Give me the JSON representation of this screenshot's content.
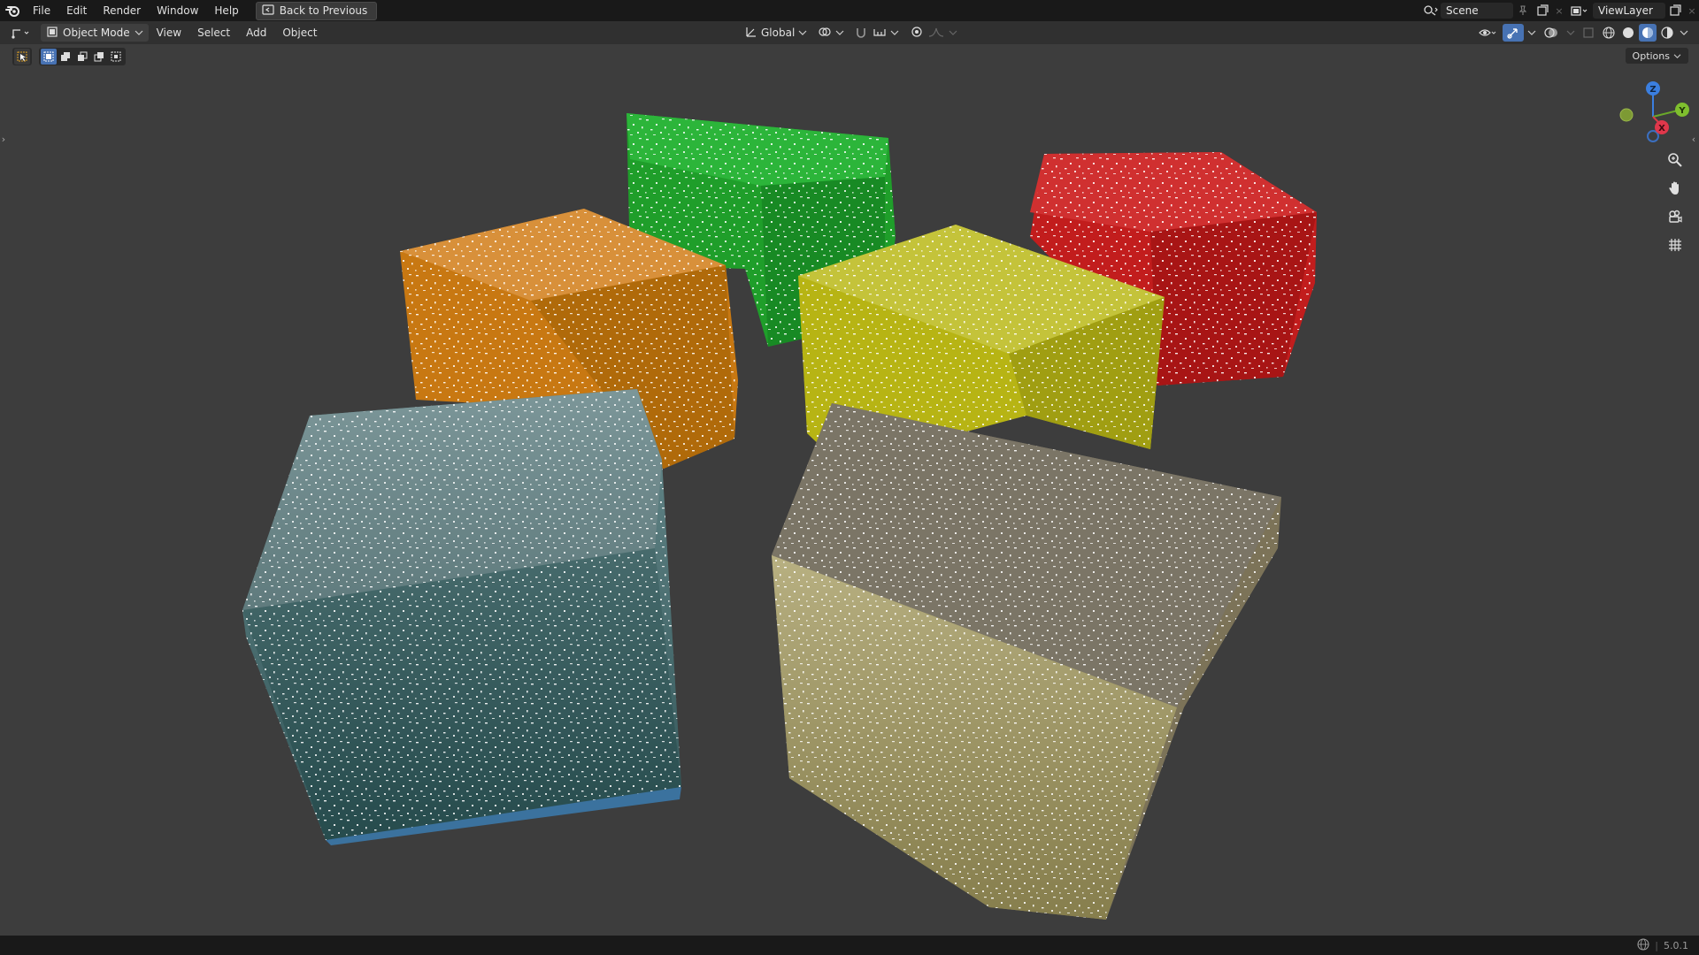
{
  "menu": {
    "file": "File",
    "edit": "Edit",
    "render": "Render",
    "window": "Window",
    "help": "Help"
  },
  "back_button": "Back to Previous",
  "scene": {
    "label": "Scene"
  },
  "view_layer": {
    "label": "ViewLayer"
  },
  "header": {
    "mode": "Object Mode",
    "view": "View",
    "select": "Select",
    "add": "Add",
    "object": "Object",
    "orientation": "Global"
  },
  "options_label": "Options",
  "gizmo": {
    "z": "Z",
    "y": "Y",
    "x": "X"
  },
  "version": "5.0.1",
  "cubes": [
    {
      "name": "green",
      "color": "#1f9e2a"
    },
    {
      "name": "red",
      "color": "#c21d1d"
    },
    {
      "name": "orange",
      "color": "#c87812"
    },
    {
      "name": "yellow",
      "color": "#b7b414"
    },
    {
      "name": "teal",
      "color": "#3f6b6e"
    },
    {
      "name": "gray",
      "color": "#7c7358"
    }
  ],
  "icons": [
    "blender-logo-icon",
    "back-icon",
    "scene-icon",
    "pin-icon",
    "new-scene-icon",
    "viewlayer-icon",
    "editor-type-icon",
    "object-mode-icon",
    "orientation-icon",
    "pivot-icon",
    "snap-icon",
    "proportional-icon",
    "visibility-icon",
    "gizmo-icon",
    "overlay-icon",
    "xray-icon",
    "wireframe-shading-icon",
    "solid-shading-icon",
    "material-shading-icon",
    "rendered-shading-icon",
    "zoom-icon",
    "hand-icon",
    "camera-icon",
    "grid-icon",
    "globe-icon"
  ]
}
